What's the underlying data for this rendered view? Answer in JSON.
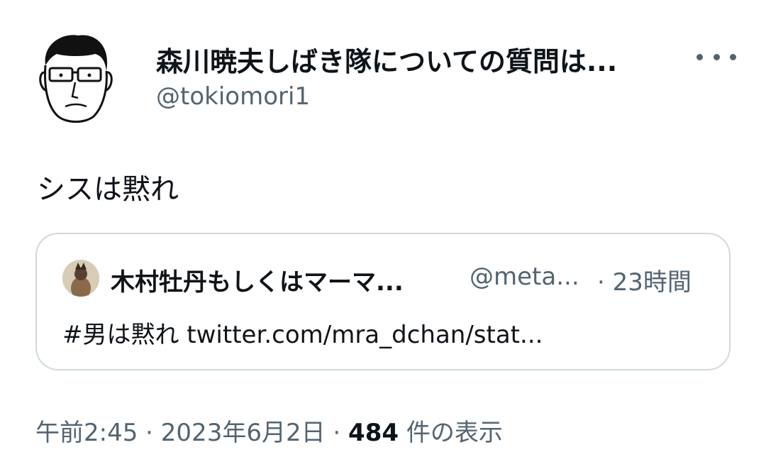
{
  "tweet": {
    "display_name": "森川暁夫しばき隊についての質問は...",
    "handle": "@tokiomori1",
    "text": "シスは黙れ",
    "more_icon": "more-horizontal-icon"
  },
  "quote": {
    "author_name": "木村牡丹もしくはマーマ...",
    "author_handle": "@meta...",
    "time": "· 23時間",
    "text": "#男は黙れ twitter.com/mra_dchan/stat..."
  },
  "meta": {
    "time": "午前2:45",
    "sep1": " · ",
    "date": "2023年6月2日",
    "sep2": " · ",
    "views_count": "484",
    "views_label": " 件の表示"
  },
  "colors": {
    "text": "#0f1419",
    "secondary": "#536471",
    "border": "#cfd9de"
  }
}
